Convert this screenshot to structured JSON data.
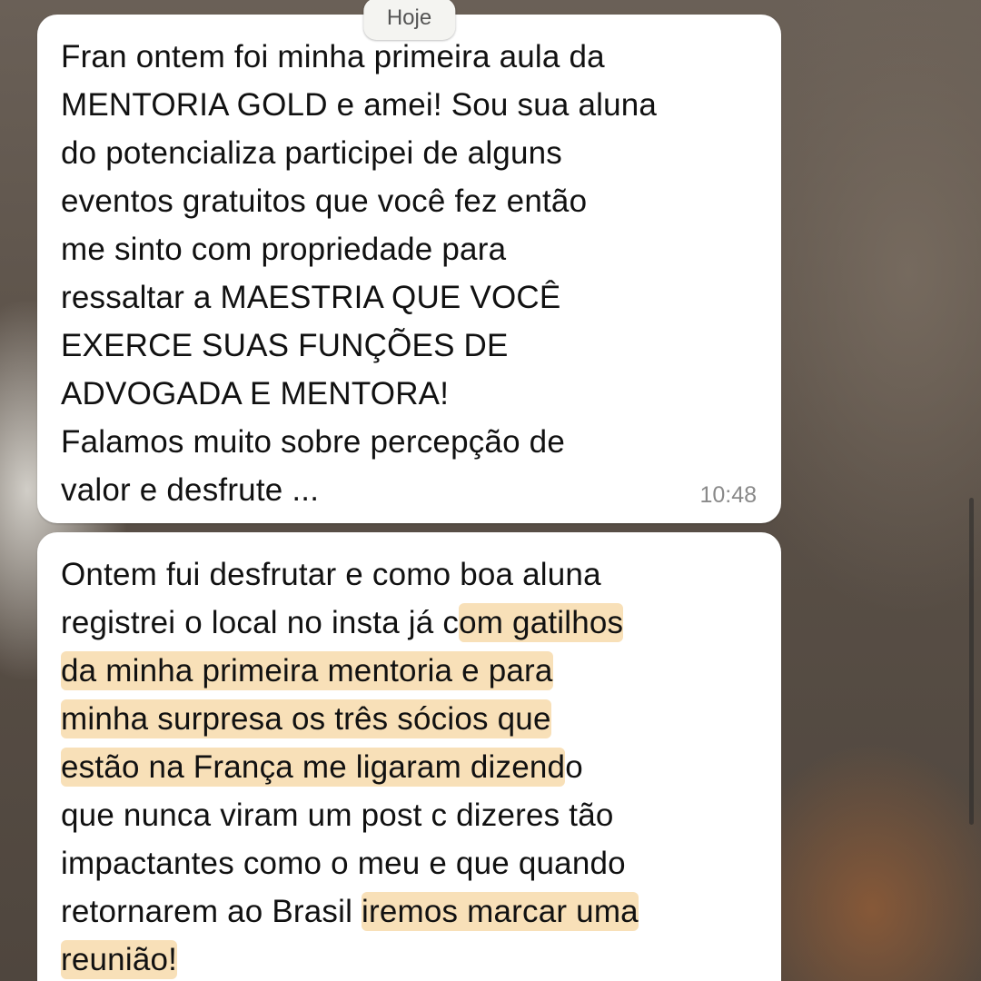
{
  "chat": {
    "date_label": "Hoje",
    "messages": [
      {
        "text": "Fran ontem foi minha primeira aula da\nMENTORIA GOLD e amei! Sou sua aluna\ndo potencializa participei de alguns\neventos gratuitos que você fez então\nme sinto com propriedade para\nressaltar a MAESTRIA QUE VOCÊ\nEXERCE SUAS FUNÇÕES DE\nADVOGADA E MENTORA!\nFalamos muito sobre percepção de\nvalor e desfrute ...",
        "time": "10:48"
      },
      {
        "segments": [
          {
            "text": "Ontem fui desfrutar e como boa aluna\nregistrei o local no insta já c",
            "highlight": false
          },
          {
            "text": "om gatilhos\nda minha primeira mentoria e para\nminha surpresa os três sócios que\nestão na França me ligaram dizend",
            "highlight": true
          },
          {
            "text": "o\nque nunca viram um post c dizeres tão\nimpactantes como o meu e que quando\nretornarem ao Brasil ",
            "highlight": false
          },
          {
            "text": "iremos marcar uma\nreunião!",
            "highlight": true
          }
        ]
      }
    ]
  },
  "colors": {
    "bubble": "#ffffff",
    "highlight": "#f5d5a0",
    "text": "#111111",
    "timestamp": "#8a8a8a"
  }
}
